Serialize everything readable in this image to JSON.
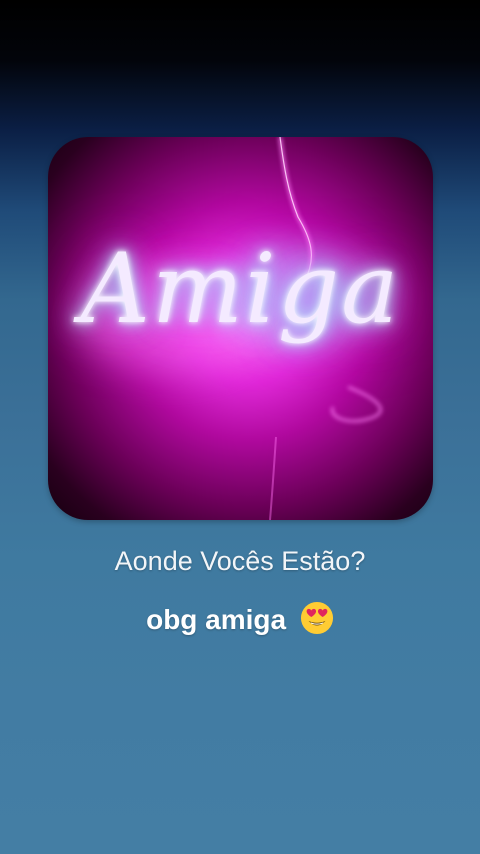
{
  "cover": {
    "text": "Amiga",
    "icon": "neon-sign-image"
  },
  "subtitle": "Aonde Vocês Estão?",
  "caption": {
    "text": "obg amiga",
    "emoji_icon": "heart-eyes-emoji-icon"
  },
  "colors": {
    "background_top": "#000000",
    "background_bottom": "#447ea4",
    "neon_pink": "#ff2ee8",
    "neon_text": "#f4eaff"
  }
}
